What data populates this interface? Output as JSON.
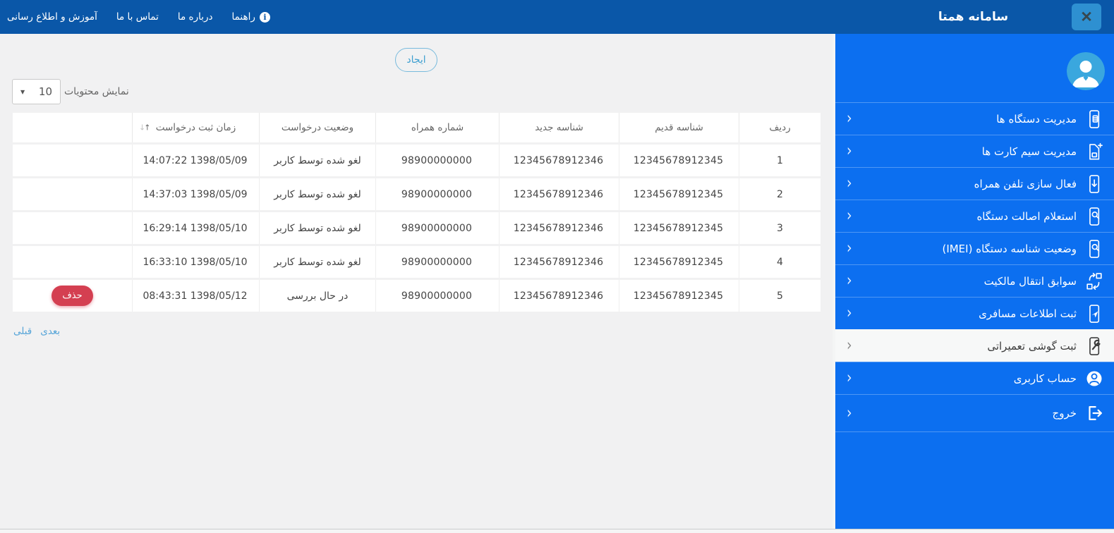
{
  "topbar": {
    "title": "سامانه همتا",
    "close_glyph": "✕",
    "nav": [
      {
        "id": "training-news",
        "label": "آموزش و اطلاع رسانی"
      },
      {
        "id": "contact-us",
        "label": "تماس با ما"
      },
      {
        "id": "about-us",
        "label": "درباره ما"
      },
      {
        "id": "help",
        "label": "راهنما",
        "icon": "info-icon"
      }
    ]
  },
  "sidebar": {
    "avatar": "user-avatar",
    "chevron_glyph": "‹",
    "items": [
      {
        "id": "device-management",
        "label": "مدیریت دستگاه ها",
        "icon": "device-management-icon",
        "active": false
      },
      {
        "id": "sim-management",
        "label": "مدیریت سیم کارت ها",
        "icon": "sim-card-icon",
        "active": false
      },
      {
        "id": "phone-activation",
        "label": "فعال سازی تلفن همراه",
        "icon": "phone-activation-icon",
        "active": false
      },
      {
        "id": "authenticity-inquiry",
        "label": "استعلام اصالت دستگاه",
        "icon": "phone-search-icon",
        "active": false
      },
      {
        "id": "imei-status",
        "label": "وضعیت شناسه دستگاه (IMEI)",
        "icon": "imei-search-icon",
        "active": false
      },
      {
        "id": "ownership-transfer",
        "label": "سوابق انتقال مالکیت",
        "icon": "transfer-icon",
        "active": false
      },
      {
        "id": "traveler-info",
        "label": "ثبت اطلاعات مسافری",
        "icon": "phone-airplane-icon",
        "active": false
      },
      {
        "id": "repair-registration",
        "label": "ثبت گوشی تعمیراتی",
        "icon": "phone-wrench-icon",
        "active": true
      },
      {
        "id": "user-account",
        "label": "حساب کاربری",
        "icon": "user-account-icon",
        "active": false
      },
      {
        "id": "logout",
        "label": "خروج",
        "icon": "logout-icon",
        "active": false
      }
    ]
  },
  "main": {
    "create_button_label": "ایجاد",
    "page_size": {
      "label": "نمایش محتویات",
      "value": "10"
    },
    "table": {
      "headers": [
        "ردیف",
        "شناسه قدیم",
        "شناسه جدید",
        "شماره همراه",
        "وضعیت درخواست",
        "زمان ثبت درخواست",
        ""
      ],
      "sort_column_index": 5,
      "rows": [
        {
          "index": "1",
          "old_id": "12345678912345",
          "new_id": "12345678912346",
          "mobile": "98900000000",
          "status": "لغو شده توسط کاربر",
          "time": "14:07:22 1398/05/09",
          "action": ""
        },
        {
          "index": "2",
          "old_id": "12345678912345",
          "new_id": "12345678912346",
          "mobile": "98900000000",
          "status": "لغو شده توسط کاربر",
          "time": "14:37:03 1398/05/09",
          "action": ""
        },
        {
          "index": "3",
          "old_id": "12345678912345",
          "new_id": "12345678912346",
          "mobile": "98900000000",
          "status": "لغو شده توسط کاربر",
          "time": "16:29:14 1398/05/10",
          "action": ""
        },
        {
          "index": "4",
          "old_id": "12345678912345",
          "new_id": "12345678912346",
          "mobile": "98900000000",
          "status": "لغو شده توسط کاربر",
          "time": "16:33:10 1398/05/10",
          "action": ""
        },
        {
          "index": "5",
          "old_id": "12345678912345",
          "new_id": "12345678912346",
          "mobile": "98900000000",
          "status": "در حال بررسی",
          "time": "08:43:31 1398/05/12",
          "action": "حذف"
        }
      ]
    },
    "pagination": {
      "prev_label": "قبلی",
      "next_label": "بعدی"
    }
  },
  "colors": {
    "topbar_bg": "#0a57a8",
    "sidebar_bg": "#0c6ff0",
    "sidebar_active_bg": "#f7f8f8",
    "close_button_bg": "#2e90d1",
    "accent_blue": "#3d9fd0",
    "delete_red": "#d43f51",
    "link_blue": "#55a4d8",
    "avatar_bg": "#3aa7de",
    "page_bg": "#f1f1f2"
  }
}
